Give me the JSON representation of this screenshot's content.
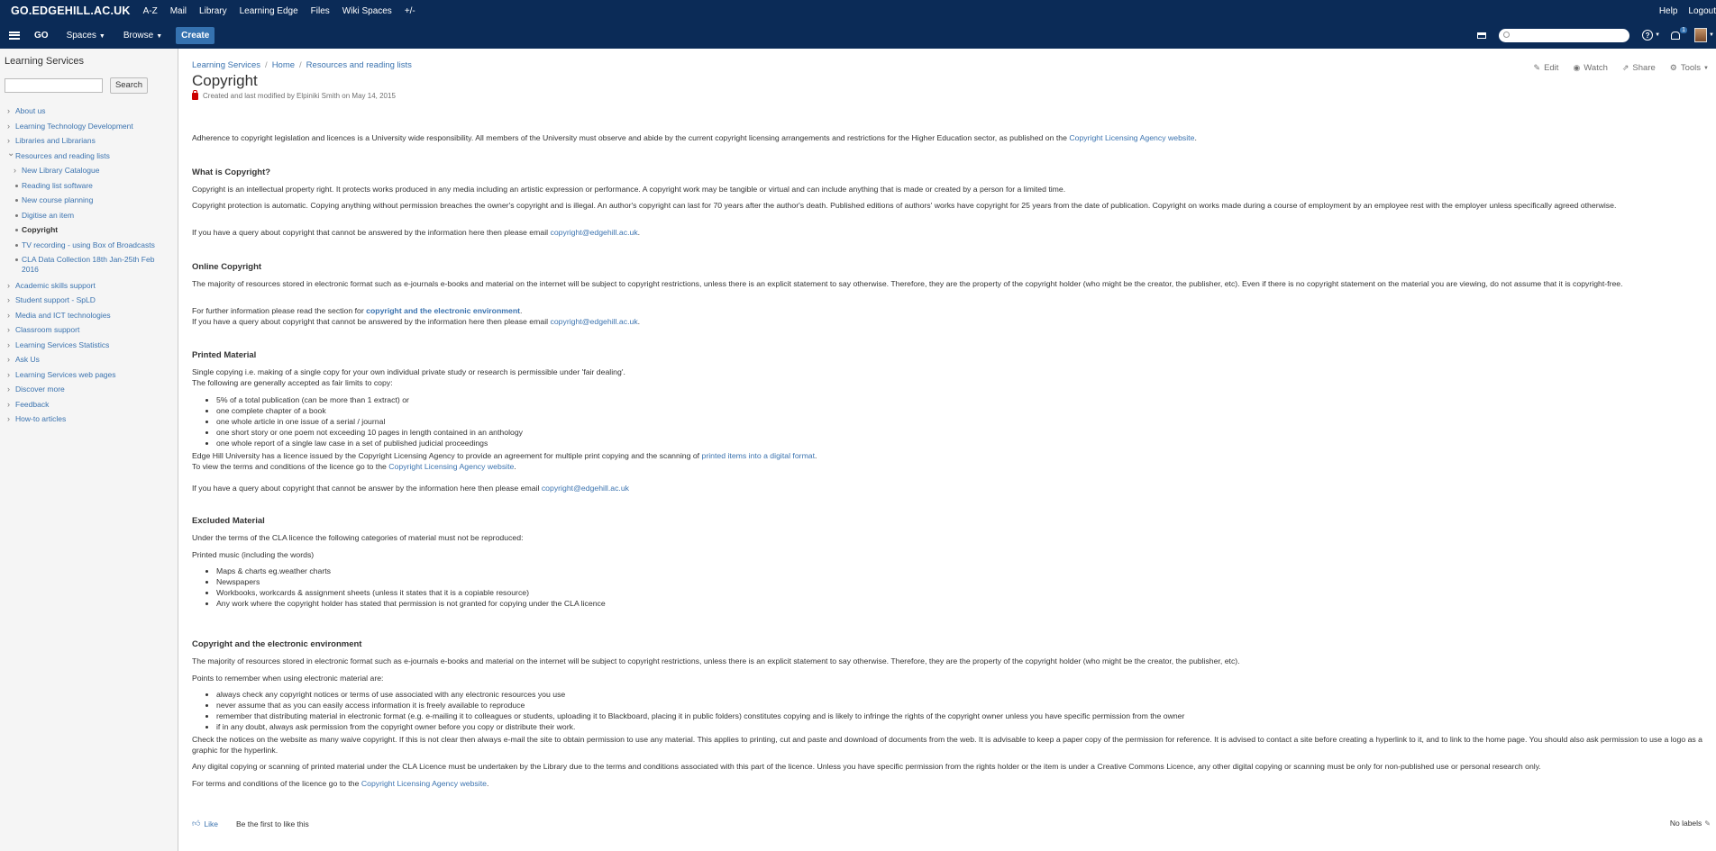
{
  "topbar": {
    "brand": "GO.EDGEHILL.AC.UK",
    "links": [
      "A-Z",
      "Mail",
      "Library",
      "Learning Edge",
      "Files",
      "Wiki Spaces",
      "+/-"
    ],
    "right": [
      "Help",
      "Logout"
    ]
  },
  "navbar": {
    "go": "GO",
    "spaces": "Spaces",
    "browse": "Browse",
    "create": "Create",
    "notification_count": "1"
  },
  "sidebar": {
    "space_title": "Learning Services",
    "search_button": "Search",
    "items": [
      {
        "label": "About us",
        "level": 0,
        "twisty": "collapsed"
      },
      {
        "label": "Learning Technology Development",
        "level": 0,
        "twisty": "collapsed"
      },
      {
        "label": "Libraries and Librarians",
        "level": 0,
        "twisty": "collapsed"
      },
      {
        "label": "Resources and reading lists",
        "level": 0,
        "twisty": "expanded"
      },
      {
        "label": "New Library Catalogue",
        "level": 1,
        "twisty": "collapsed"
      },
      {
        "label": "Reading list software",
        "level": 1,
        "twisty": "bullet"
      },
      {
        "label": "New course planning",
        "level": 1,
        "twisty": "bullet"
      },
      {
        "label": "Digitise an item",
        "level": 1,
        "twisty": "bullet"
      },
      {
        "label": "Copyright",
        "level": 1,
        "twisty": "bullet",
        "current": true
      },
      {
        "label": "TV recording - using Box of Broadcasts",
        "level": 1,
        "twisty": "bullet"
      },
      {
        "label": "CLA Data Collection 18th Jan-25th Feb 2016",
        "level": 1,
        "twisty": "bullet"
      },
      {
        "label": "Academic skills support",
        "level": 0,
        "twisty": "collapsed"
      },
      {
        "label": "Student support - SpLD",
        "level": 0,
        "twisty": "collapsed"
      },
      {
        "label": "Media and ICT technologies",
        "level": 0,
        "twisty": "collapsed"
      },
      {
        "label": "Classroom support",
        "level": 0,
        "twisty": "collapsed"
      },
      {
        "label": "Learning Services Statistics",
        "level": 0,
        "twisty": "collapsed"
      },
      {
        "label": "Ask Us",
        "level": 0,
        "twisty": "collapsed"
      },
      {
        "label": "Learning Services web pages",
        "level": 0,
        "twisty": "collapsed"
      },
      {
        "label": "Discover more",
        "level": 0,
        "twisty": "collapsed"
      },
      {
        "label": "Feedback",
        "level": 0,
        "twisty": "collapsed"
      },
      {
        "label": "How-to articles",
        "level": 0,
        "twisty": "collapsed"
      }
    ]
  },
  "breadcrumb": [
    "Learning Services",
    "Home",
    "Resources and reading lists"
  ],
  "page": {
    "title": "Copyright",
    "byline": "Created and last modified by Elpiniki Smith on May 14, 2015",
    "actions": {
      "edit": "Edit",
      "watch": "Watch",
      "share": "Share",
      "tools": "Tools"
    }
  },
  "content": {
    "intro": "Adherence to copyright legislation and licences is a University wide responsibility. All members of the University must observe and abide by the current copyright licensing arrangements and restrictions for the Higher Education sector, as published on the ",
    "intro_link": "Copyright Licensing Agency website",
    "what_heading": "What is Copyright?",
    "what_p1": "Copyright is an intellectual property right. It protects works produced in any media including an artistic expression or performance. A copyright work may be tangible or virtual and can include anything that is made or created by a person for a limited time.",
    "what_p2": "Copyright protection is automatic. Copying anything without permission breaches the owner's copyright and is illegal. An author's copyright can last for 70 years after the author's death. Published editions of authors' works have copyright for 25 years from the date of publication. Copyright on works made during a course of employment by an employee rest with the employer unless specifically agreed otherwise.",
    "query_text": "If you have a query about copyright that cannot be answered by the information here then please email ",
    "email": "copyright@edgehill.ac.uk",
    "online_heading": "Online Copyright",
    "online_p1": "The majority of resources stored in electronic format such as e-journals e-books and material on the internet will be subject to copyright restrictions, unless there is an explicit statement to say otherwise. Therefore, they are the property of the copyright holder (who might be the creator, the publisher, etc). Even if there is no copyright statement on the material you are viewing, do not assume that it is copyright-free.",
    "further_text": "For further information please read the section for ",
    "further_link": "copyright and the electronic environment",
    "printed_heading": "Printed Material",
    "printed_p1": "Single copying i.e. making of a single copy for your own individual private study or research is permissible under 'fair dealing'.",
    "printed_p2": "The following are generally accepted as fair limits to copy:",
    "printed_list": [
      "5% of a total publication (can be more than 1 extract) or",
      "one complete chapter of a book",
      "one whole article in one issue of a serial / journal",
      "one short story or one poem not exceeding 10 pages in length contained in an anthology",
      "one whole report of a single law case in a set of published judicial proceedings"
    ],
    "licence_text": "Edge Hill University has a licence issued by the Copyright Licensing Agency to provide an agreement for multiple print copying and the scanning of ",
    "licence_link": "printed items into a digital format",
    "terms_text": " To view the terms and conditions of the licence go to the ",
    "terms_link": "Copyright Licensing Agency website",
    "query_text2": "If you have a query about copyright that cannot be answer by the information here then please email ",
    "excluded_heading": "Excluded Material",
    "excluded_p1": "Under the terms of the CLA licence the following categories of material must not be reproduced:",
    "excluded_p2": "Printed music (including the words)",
    "excluded_list": [
      "Maps & charts eg.weather charts",
      "Newspapers",
      "Workbooks, workcards & assignment sheets (unless it states that it is a copiable resource)",
      "Any work where the copyright holder has stated that permission is not granted for copying under the CLA licence"
    ],
    "electronic_heading": "Copyright and the electronic environment",
    "electronic_p1": "The majority of resources stored in electronic format such as e-journals e-books and material on the internet will be subject to copyright restrictions, unless there is an explicit statement to say otherwise. Therefore, they are the property of the copyright holder (who might be the creator, the publisher, etc).",
    "points_intro": "Points to remember when using electronic material are:",
    "points_list": [
      "always check any copyright notices or terms of use associated with any electronic resources you use",
      "never assume that as you can easily access information it is freely available to reproduce",
      "remember that distributing material in electronic format (e.g. e-mailing it to colleagues or students, uploading it to Blackboard, placing it in public folders) constitutes copying and is likely to infringe the rights of the copyright owner unless you have specific permission from the owner",
      "if in any doubt, always ask permission from the copyright owner before you copy or distribute their work."
    ],
    "check_notices": "Check the notices on the website as many waive copyright.  If this is not clear then always e-mail the site to obtain permission to use any material. This applies to printing, cut and paste and download of documents from the web. It is advisable to keep a paper copy of the permission for reference. It is advised to contact a site before creating a hyperlink to it, and to link to the home page.  You should also ask permission to use a logo as a graphic for the hyperlink.",
    "digital_copying": "Any digital copying or scanning of printed material under the CLA Licence must be undertaken by the Library due to the terms and conditions associated with this part of the licence. Unless you have specific permission from the rights holder or the item is under a Creative Commons Licence, any other digital copying or scanning must be only for non-published use or personal research only.",
    "final_text": "For terms and conditions of the licence go to the ",
    "final_link": "Copyright Licensing Agency website"
  },
  "footer": {
    "like": "Like",
    "first": "Be the first to like this",
    "labels": "No labels"
  }
}
